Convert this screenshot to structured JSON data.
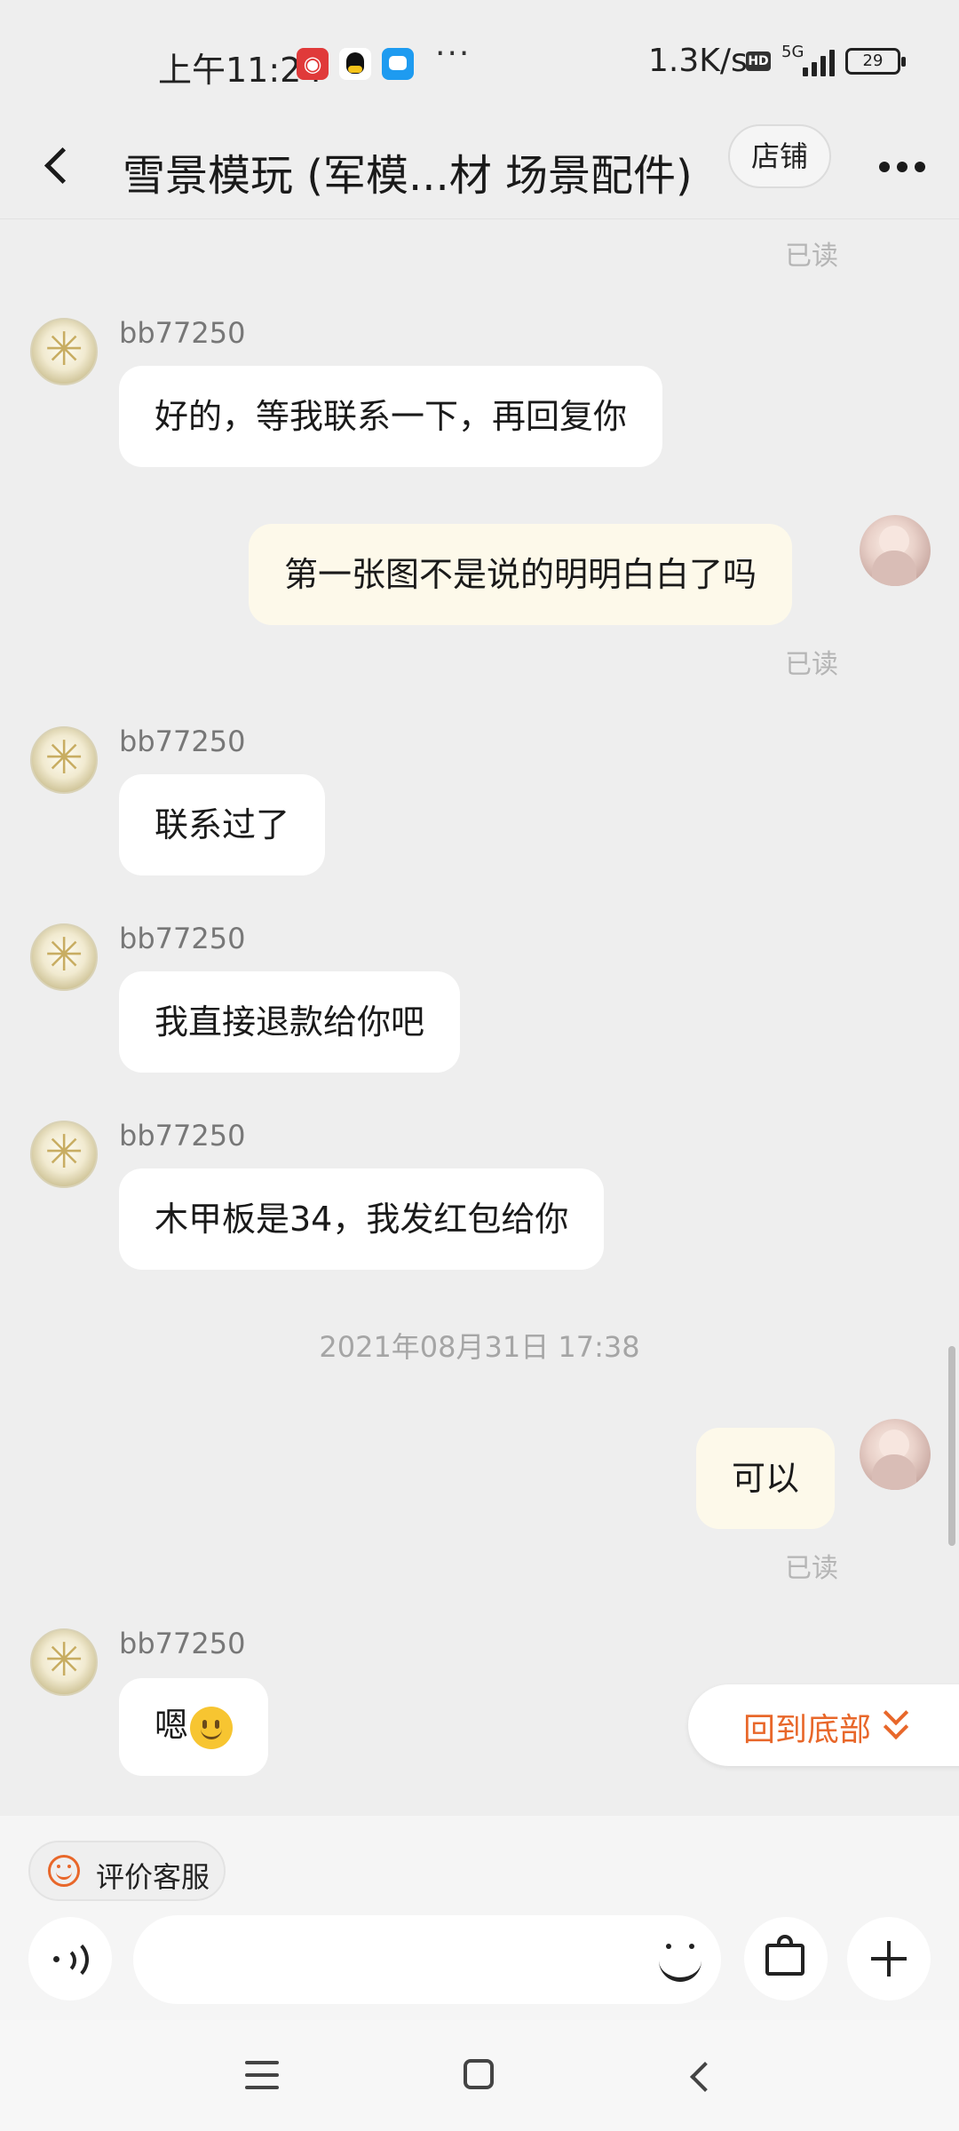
{
  "status_bar": {
    "time": "上午11:24",
    "more_dots": "···",
    "net_speed": "1.3K/s",
    "hd": "HD",
    "network": "5G",
    "battery": "29"
  },
  "header": {
    "title": "雪景模玩 (军模...材 场景配件)",
    "shop_label": "店铺"
  },
  "chat": {
    "read_label": "已读",
    "shop_name": "bb77250",
    "messages": [
      {
        "text": "好的，等我联系一下，再回复你"
      },
      {
        "text": "第一张图不是说的明明白白了吗"
      },
      {
        "text": "联系过了"
      },
      {
        "text": "我直接退款给你吧"
      },
      {
        "text": "木甲板是34，我发红包给你"
      },
      {
        "text": "可以"
      },
      {
        "text": "嗯"
      }
    ],
    "timestamp": "2021年08月31日 17:38"
  },
  "back_to_bottom": {
    "label": "回到底部"
  },
  "bottom_bar": {
    "rate_label": "评价客服",
    "input_value": "",
    "input_placeholder": ""
  },
  "colors": {
    "accent": "#e8672a",
    "background": "#eeeeee",
    "incoming_bubble": "#ffffff",
    "outgoing_bubble": "#fdf9ea"
  }
}
